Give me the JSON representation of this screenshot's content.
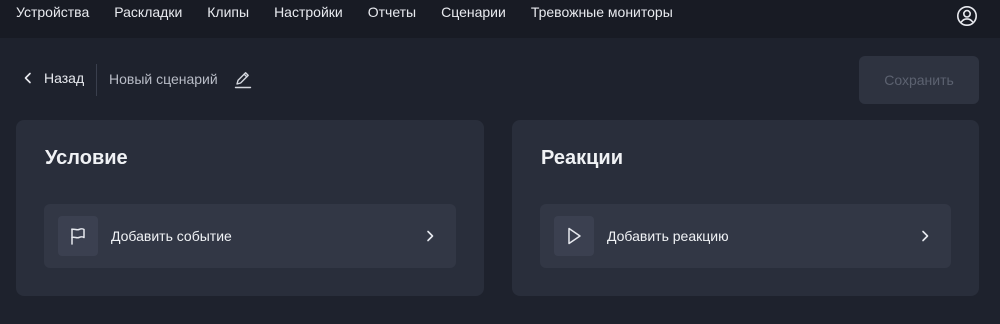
{
  "nav": {
    "items": [
      {
        "label": "Устройства"
      },
      {
        "label": "Раскладки"
      },
      {
        "label": "Клипы"
      },
      {
        "label": "Настройки"
      },
      {
        "label": "Отчеты"
      },
      {
        "label": "Сценарии"
      },
      {
        "label": "Тревожные мониторы"
      }
    ],
    "user_icon": "user-circle-icon"
  },
  "toolbar": {
    "back_label": "Назад",
    "scenario_name": "Новый сценарий",
    "save_label": "Сохранить"
  },
  "condition": {
    "title": "Условие",
    "action_label": "Добавить событие",
    "icon": "flag-icon"
  },
  "reactions": {
    "title": "Реакции",
    "action_label": "Добавить реакцию",
    "icon": "play-icon"
  },
  "colors": {
    "page_bg": "#1e222d",
    "nav_bg": "#181b24",
    "card_bg": "#292e3b",
    "row_bg": "#323745",
    "save_disabled_bg": "#2e3340"
  }
}
